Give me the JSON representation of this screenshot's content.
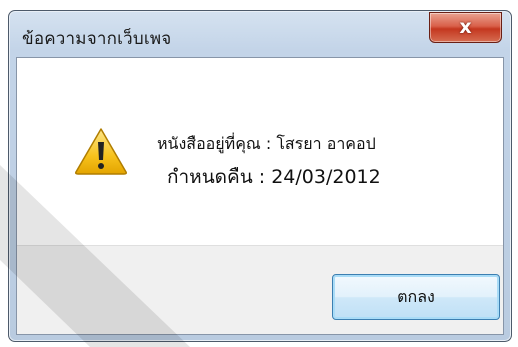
{
  "dialog": {
    "title": "ข้อความจากเว็บเพจ",
    "close_label": "x",
    "icon": "warning-icon",
    "message_line1": "หนังสืออยู่ที่คุณ : โสรยา อาคอป",
    "message_line2": "กำหนดคืน : 24/03/2012",
    "ok_label": "ตกลง"
  },
  "colors": {
    "warning_yellow": "#f7c21c",
    "close_red": "#c4371f",
    "ok_border": "#3c7fb1"
  }
}
